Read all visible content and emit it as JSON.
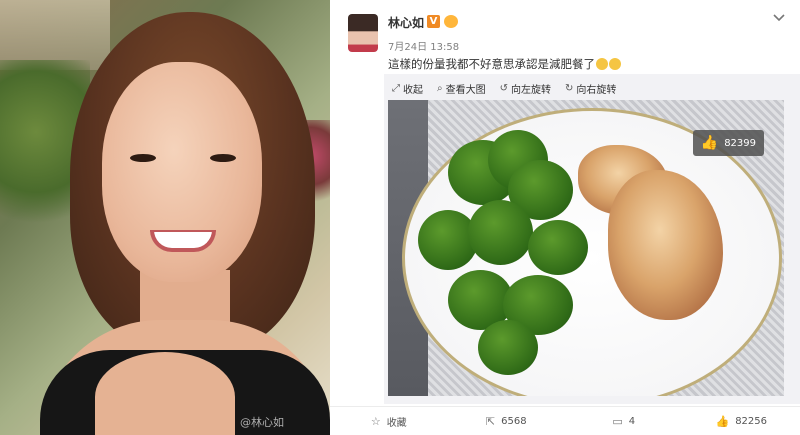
{
  "post": {
    "author": "林心如",
    "time": "7月24日 13:58",
    "text": "這樣的份量我都不好意思承認是減肥餐了",
    "image_like_count": "82399",
    "photo_watermark": "@林心如"
  },
  "image_toolbar": {
    "collapse": "收起",
    "view_large": "查看大图",
    "rotate_left": "向左旋转",
    "rotate_right": "向右旋转"
  },
  "actions": {
    "favorite": "收藏",
    "repost_count": "6568",
    "comment_count": "4",
    "like_count": "82256"
  },
  "icons": {
    "verified": "verified-badge-icon",
    "vip": "vip-crown-icon",
    "chevron": "chevron-down-icon",
    "star": "star-icon",
    "repost": "share-icon",
    "comment": "comment-icon",
    "like": "thumbs-up-icon"
  },
  "colors": {
    "verified_badge": "#f08a24",
    "vip_badge": "#ffb63b",
    "text_primary": "#333333",
    "text_muted": "#808080"
  }
}
